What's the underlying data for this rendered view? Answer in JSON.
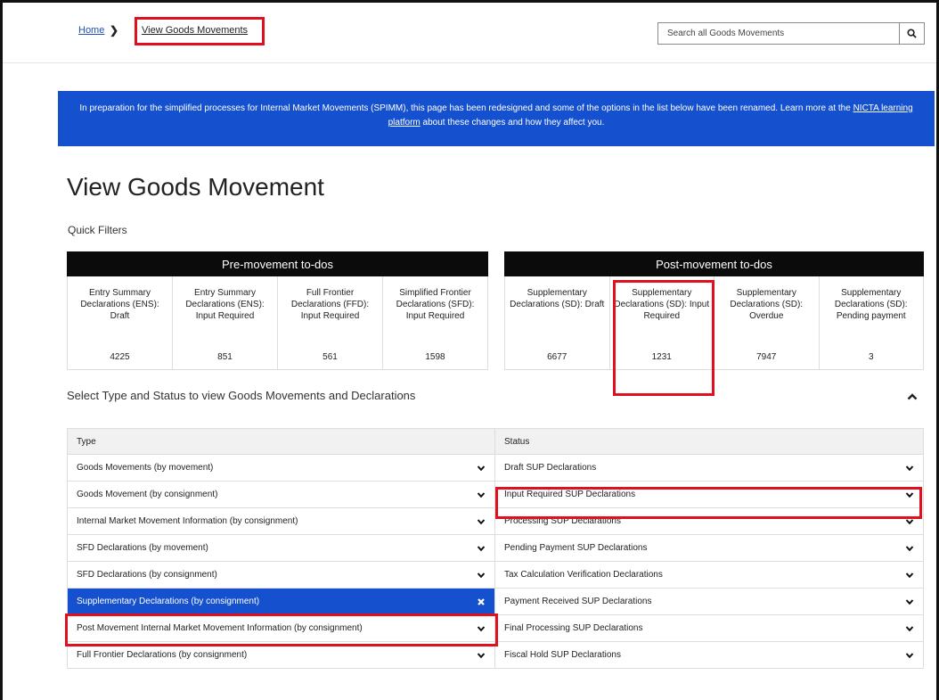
{
  "breadcrumb": {
    "home": "Home",
    "current": "View Goods Movements"
  },
  "search": {
    "placeholder": "Search all Goods Movements"
  },
  "banner": {
    "text_before": "In preparation for the simplified processes for Internal Market Movements (SPIMM), this page has been redesigned and some of the options in the list below have been renamed. Learn more at the ",
    "link": "NICTA learning platform",
    "text_after": " about these changes and how they affect you."
  },
  "page_title": "View Goods Movement",
  "quick_filters_label": "Quick Filters",
  "pre_movement": {
    "title": "Pre-movement to-dos",
    "tiles": [
      {
        "label": "Entry Summary Declarations (ENS): Draft",
        "count": "4225"
      },
      {
        "label": "Entry Summary Declarations (ENS): Input Required",
        "count": "851"
      },
      {
        "label": "Full Frontier Declarations (FFD): Input Required",
        "count": "561"
      },
      {
        "label": "Simplified Frontier Declarations (SFD): Input Required",
        "count": "1598"
      }
    ]
  },
  "post_movement": {
    "title": "Post-movement to-dos",
    "tiles": [
      {
        "label": "Supplementary Declarations (SD): Draft",
        "count": "6677"
      },
      {
        "label": "Supplementary Declarations (SD): Input Required",
        "count": "1231"
      },
      {
        "label": "Supplementary Declarations (SD): Overdue",
        "count": "7947"
      },
      {
        "label": "Supplementary Declarations (SD): Pending payment",
        "count": "3"
      }
    ]
  },
  "select_section": {
    "heading": "Select Type and Status to view Goods Movements and Declarations",
    "type_header": "Type",
    "status_header": "Status",
    "types": [
      "Goods Movements (by movement)",
      "Goods Movement (by consignment)",
      "Internal Market Movement Information (by consignment)",
      "SFD Declarations (by movement)",
      "SFD Declarations (by consignment)",
      "Supplementary Declarations (by consignment)",
      "Post Movement Internal Market Movement Information (by consignment)",
      "Full Frontier Declarations (by consignment)"
    ],
    "statuses": [
      "Draft SUP Declarations",
      "Input Required SUP Declarations",
      "Processing SUP Declarations",
      "Pending Payment SUP Declarations",
      "Tax Calculation Verification Declarations",
      "Payment Received SUP Declarations",
      "Final Processing SUP Declarations",
      "Fiscal Hold SUP Declarations"
    ]
  },
  "colors": {
    "brand_blue": "#1551cf",
    "highlight_red": "#e0101e",
    "header_black": "#0b0b0b"
  },
  "icons": {
    "search": "search-icon",
    "chevron": "chevron-down-icon",
    "collapse": "chevron-up-icon",
    "clear": "close-icon"
  }
}
